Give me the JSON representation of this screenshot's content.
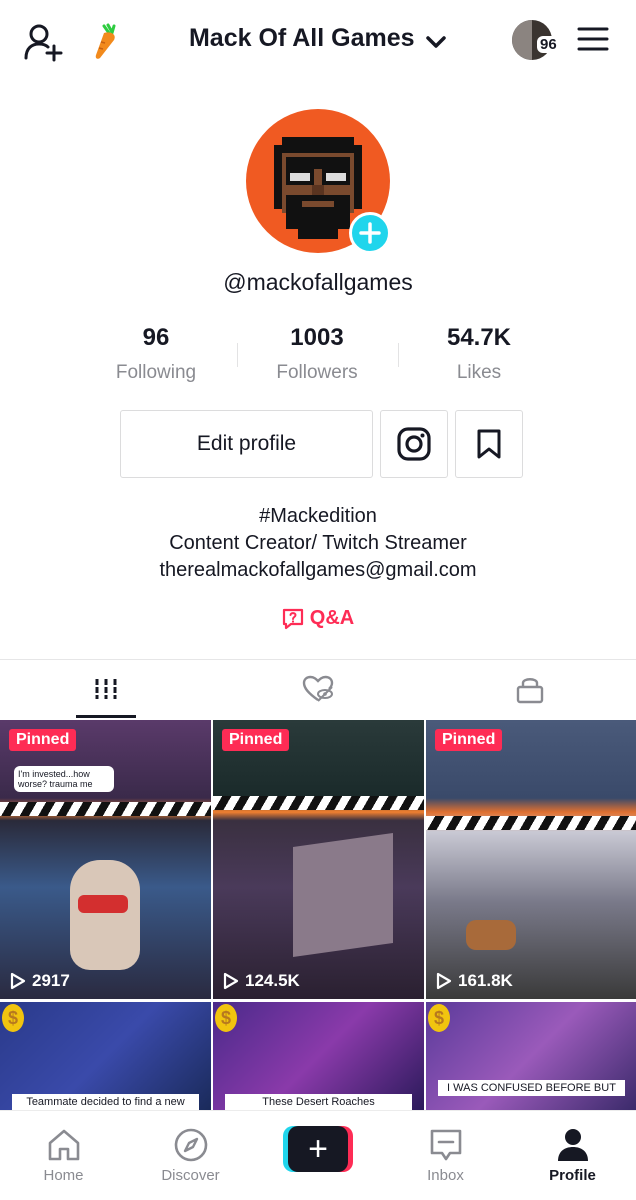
{
  "header": {
    "title": "Mack Of All Games",
    "avatar_badge": "96",
    "icons": [
      "add-user-icon",
      "carrot-icon",
      "chevron-down-icon",
      "menu-icon"
    ]
  },
  "profile": {
    "handle": "@mackofallgames",
    "avatar_bg": "#f05a22",
    "add_badge_color": "#20d5ec"
  },
  "stats": [
    {
      "value": "96",
      "label": "Following"
    },
    {
      "value": "1003",
      "label": "Followers"
    },
    {
      "value": "54.7K",
      "label": "Likes"
    }
  ],
  "actions": {
    "edit_profile": "Edit profile",
    "instagram_icon": "instagram-icon",
    "bookmark_icon": "bookmark-icon"
  },
  "bio": {
    "line1": "#Mackedition",
    "line2": "Content Creator/ Twitch Streamer",
    "line3": "therealmackofallgames@gmail.com",
    "qa_label": "Q&A"
  },
  "tabs": [
    {
      "icon": "videos-grid-icon",
      "active": true
    },
    {
      "icon": "liked-hidden-icon",
      "active": false
    },
    {
      "icon": "lock-icon",
      "active": false
    }
  ],
  "videos": [
    {
      "badge": "Pinned",
      "views": "2917",
      "overlay_text": "I'm invested...how worse? trauma me"
    },
    {
      "badge": "Pinned",
      "views": "124.5K"
    },
    {
      "badge": "Pinned",
      "views": "161.8K"
    },
    {
      "caption": "Teammate decided to find a new"
    },
    {
      "caption": "These Desert Roaches"
    },
    {
      "caption": "I WAS CONFUSED BEFORE BUT"
    }
  ],
  "bottom_nav": [
    {
      "label": "Home",
      "icon": "home-icon"
    },
    {
      "label": "Discover",
      "icon": "compass-icon"
    },
    {
      "label": "",
      "icon": "create-plus-icon"
    },
    {
      "label": "Inbox",
      "icon": "inbox-icon"
    },
    {
      "label": "Profile",
      "icon": "profile-icon",
      "active": true
    }
  ],
  "colors": {
    "accent": "#fe2c55",
    "secondary_accent": "#20d5ec",
    "text": "#161823",
    "muted": "#8a8b91"
  }
}
